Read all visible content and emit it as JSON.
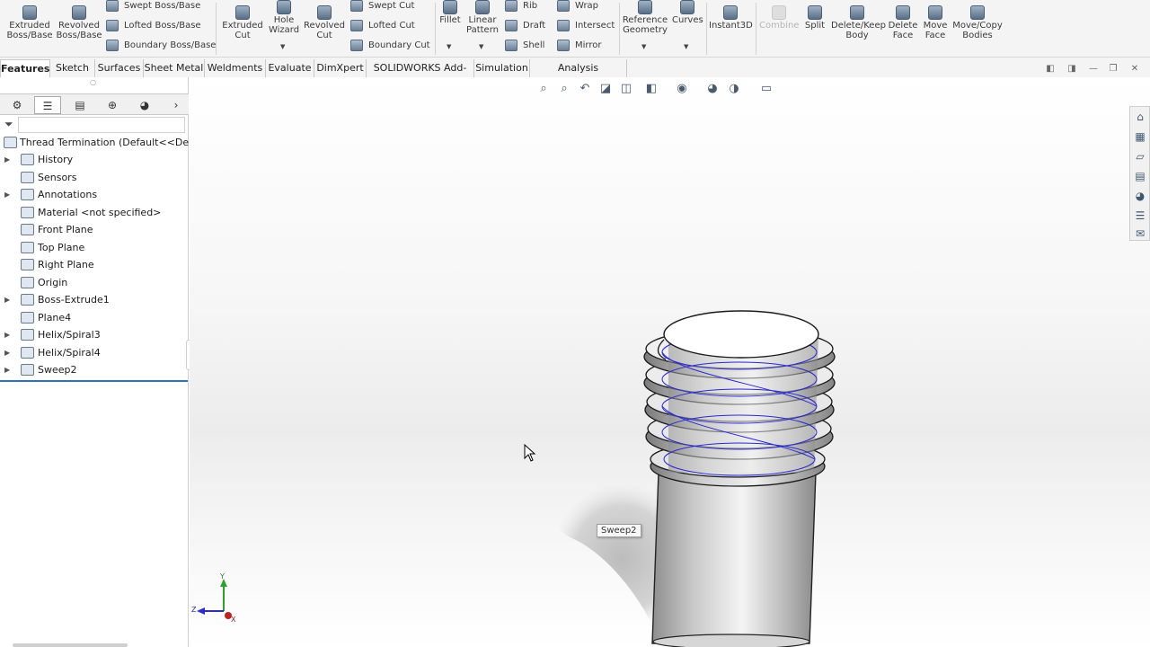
{
  "ribbon": {
    "extruded_boss": "Extruded\nBoss/Base",
    "revolved_boss": "Revolved\nBoss/Base",
    "swept_boss": "Swept Boss/Base",
    "lofted_boss": "Lofted Boss/Base",
    "boundary_boss": "Boundary Boss/Base",
    "extruded_cut": "Extruded\nCut",
    "hole_wizard": "Hole\nWizard",
    "revolved_cut": "Revolved\nCut",
    "swept_cut": "Swept Cut",
    "lofted_cut": "Lofted Cut",
    "boundary_cut": "Boundary Cut",
    "fillet": "Fillet",
    "linear_pattern": "Linear\nPattern",
    "rib": "Rib",
    "draft": "Draft",
    "shell": "Shell",
    "wrap": "Wrap",
    "intersect": "Intersect",
    "mirror": "Mirror",
    "reference_geometry": "Reference\nGeometry",
    "curves": "Curves",
    "instant3d": "Instant3D",
    "combine": "Combine",
    "split": "Split",
    "delete_keep_body": "Delete/Keep\nBody",
    "delete_face": "Delete\nFace",
    "move_face": "Move\nFace",
    "move_copy_bodies": "Move/Copy\nBodies"
  },
  "tabs": [
    "Features",
    "Sketch",
    "Surfaces",
    "Sheet Metal",
    "Weldments",
    "Evaluate",
    "DimXpert",
    "SOLIDWORKS Add-Ins",
    "Simulation",
    "Analysis Preparation"
  ],
  "tree": {
    "root": "Thread Termination  (Default<<Default>",
    "items": [
      "History",
      "Sensors",
      "Annotations",
      "Material <not specified>",
      "Front Plane",
      "Top Plane",
      "Right Plane",
      "Origin",
      "Boss-Extrude1",
      "Plane4",
      "Helix/Spiral3",
      "Helix/Spiral4",
      "Sweep2"
    ]
  },
  "viewport": {
    "tooltip": "Sweep2",
    "triad_x": "X",
    "triad_y": "Y",
    "triad_z": "Z"
  },
  "colors": {
    "helix_line": "#2a2ad0",
    "selection_line": "#2e6fbe",
    "ribbon_bg": "#f4f4f4"
  }
}
